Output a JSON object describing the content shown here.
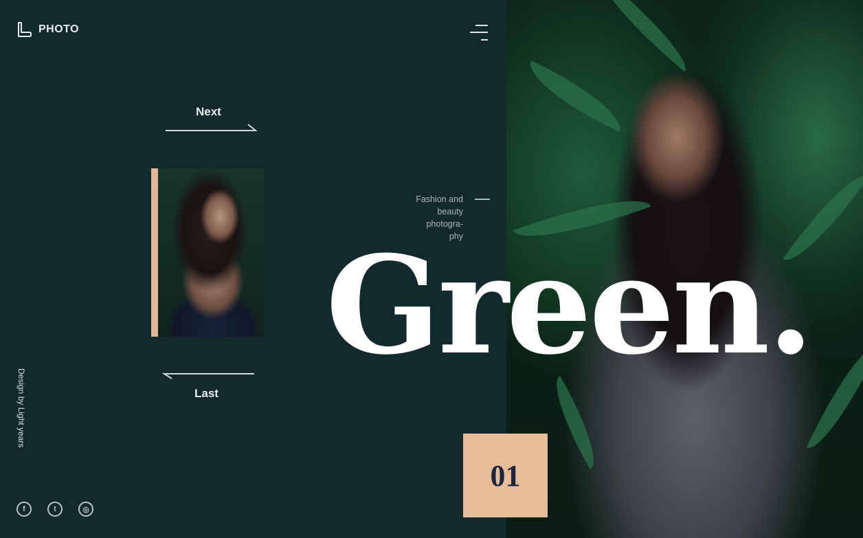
{
  "brand": {
    "name": "PHOTO",
    "icon": "logo-l-icon"
  },
  "header": {
    "menu_icon": "hamburger-menu-icon"
  },
  "navigation": {
    "next_label": "Next",
    "last_label": "Last"
  },
  "hero": {
    "title": "Green.",
    "tagline_lines": [
      "Fashion and",
      "beauty",
      "photogra-",
      "phy"
    ],
    "slide_number": "01"
  },
  "footer": {
    "credit": "Design by Light years",
    "social": [
      {
        "name": "facebook",
        "icon": "facebook-icon",
        "glyph": "f"
      },
      {
        "name": "twitter",
        "icon": "twitter-icon",
        "glyph": "t"
      },
      {
        "name": "dribbble",
        "icon": "dribbble-icon",
        "glyph": "◎"
      }
    ]
  },
  "colors": {
    "background": "#12292d",
    "accent": "#e6bd98",
    "number": "#1d2540",
    "title": "#ffffff"
  }
}
